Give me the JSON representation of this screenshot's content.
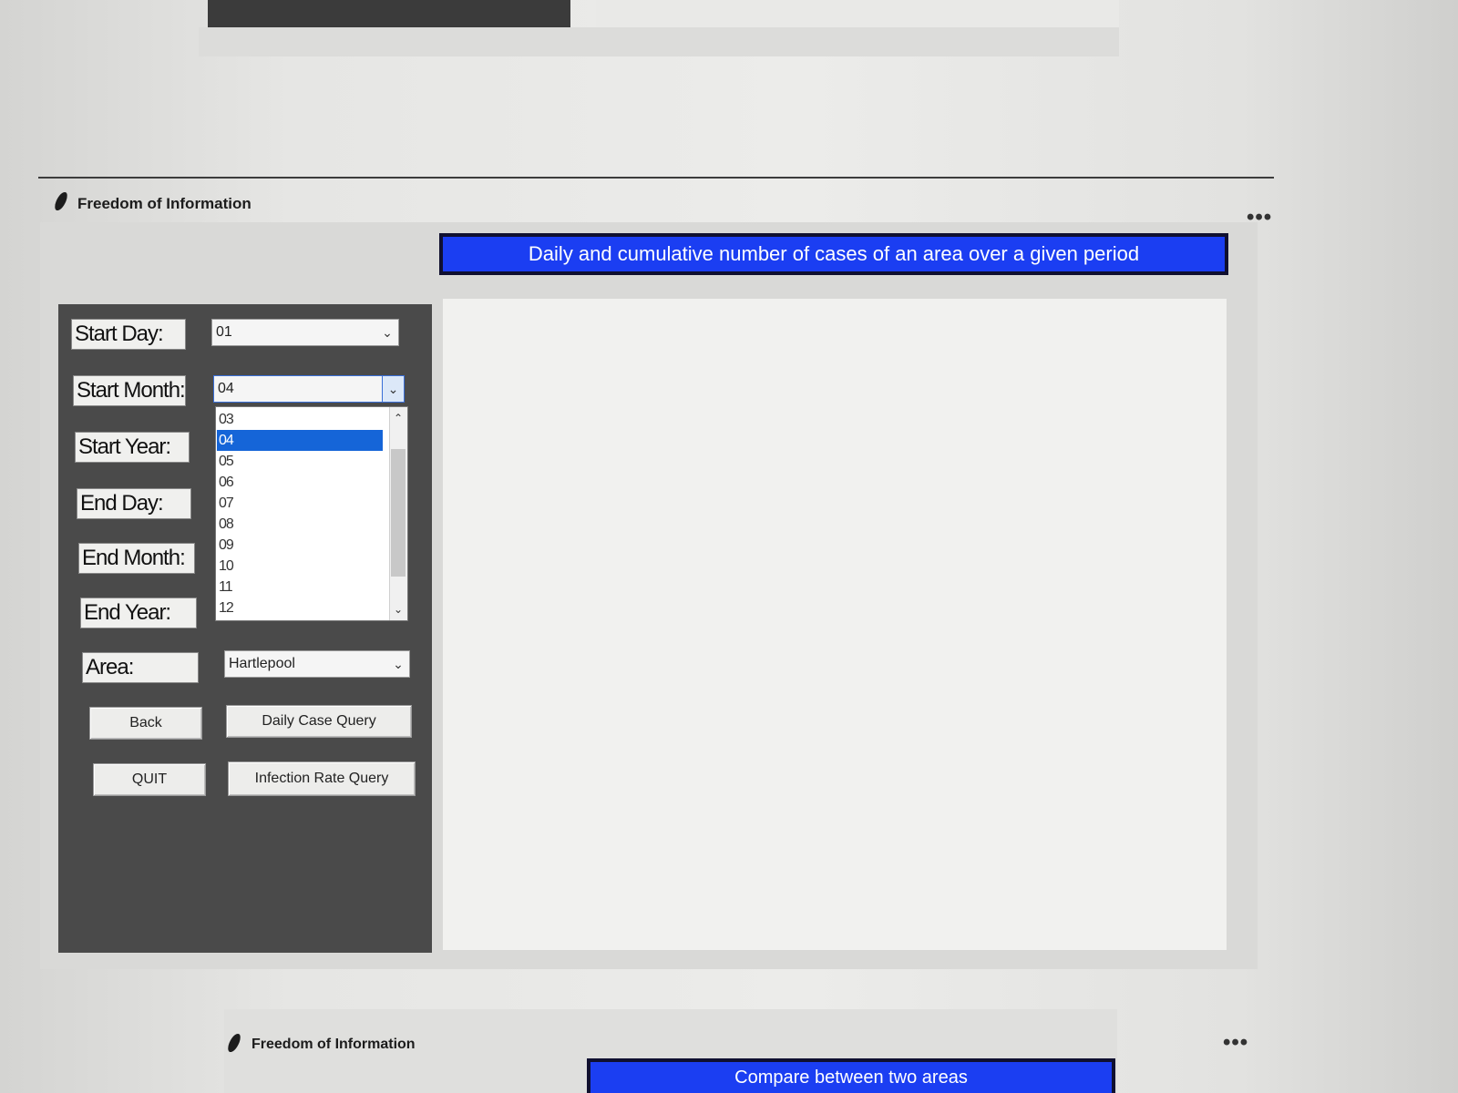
{
  "window": {
    "title": "Freedom of Information",
    "menu_dots": "•••",
    "banner": "Daily and cumulative number of cases of an area over a given period"
  },
  "form": {
    "start_day_label": "Start Day:",
    "start_day_value": "01",
    "start_month_label": "Start Month:",
    "start_month_value": "04",
    "start_year_label": "Start Year:",
    "end_day_label": "End Day:",
    "end_month_label": "End Month:",
    "end_year_label": "End Year:",
    "area_label": "Area:",
    "area_value": "Hartlepool"
  },
  "dropdown": {
    "items": [
      "03",
      "04",
      "05",
      "06",
      "07",
      "08",
      "09",
      "10",
      "11",
      "12"
    ],
    "selected": "04"
  },
  "buttons": {
    "back": "Back",
    "daily_case_query": "Daily Case Query",
    "quit": "QUIT",
    "infection_rate_query": "Infection Rate Query"
  },
  "second_window": {
    "title": "Freedom of Information",
    "menu_dots": "•••",
    "banner": "Compare between two areas"
  },
  "colors": {
    "banner_blue": "#1b3ef2",
    "selection_blue": "#1565d8",
    "panel_dark": "#4a4a4a"
  },
  "icons": {
    "title_icon": "feather-icon",
    "combo_arrow": "chevron-down-icon"
  }
}
